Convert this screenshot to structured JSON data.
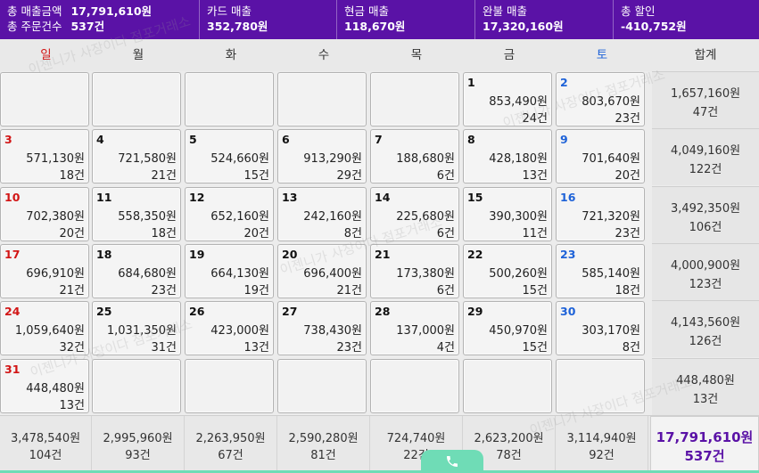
{
  "header": {
    "total_sales_label": "총 매출금액",
    "total_sales_value": "17,791,610원",
    "total_orders_label": "총 주문건수",
    "total_orders_value": "537건",
    "card_label": "카드 매출",
    "card_value": "352,780원",
    "cash_label": "현금 매출",
    "cash_value": "118,670원",
    "complete_label": "완불 매출",
    "complete_value": "17,320,160원",
    "discount_label": "총 할인",
    "discount_value": "-410,752원"
  },
  "weekdays": [
    "일",
    "월",
    "화",
    "수",
    "목",
    "금",
    "토"
  ],
  "sum_header": "합계",
  "weeks": [
    {
      "days": [
        null,
        null,
        null,
        null,
        null,
        {
          "day": "1",
          "amount": "853,490원",
          "count": "24건"
        },
        {
          "day": "2",
          "amount": "803,670원",
          "count": "23건"
        }
      ],
      "sum_amount": "1,657,160원",
      "sum_count": "47건"
    },
    {
      "days": [
        {
          "day": "3",
          "amount": "571,130원",
          "count": "18건"
        },
        {
          "day": "4",
          "amount": "721,580원",
          "count": "21건"
        },
        {
          "day": "5",
          "amount": "524,660원",
          "count": "15건"
        },
        {
          "day": "6",
          "amount": "913,290원",
          "count": "29건"
        },
        {
          "day": "7",
          "amount": "188,680원",
          "count": "6건"
        },
        {
          "day": "8",
          "amount": "428,180원",
          "count": "13건"
        },
        {
          "day": "9",
          "amount": "701,640원",
          "count": "20건"
        }
      ],
      "sum_amount": "4,049,160원",
      "sum_count": "122건"
    },
    {
      "days": [
        {
          "day": "10",
          "amount": "702,380원",
          "count": "20건"
        },
        {
          "day": "11",
          "amount": "558,350원",
          "count": "18건"
        },
        {
          "day": "12",
          "amount": "652,160원",
          "count": "20건"
        },
        {
          "day": "13",
          "amount": "242,160원",
          "count": "8건"
        },
        {
          "day": "14",
          "amount": "225,680원",
          "count": "6건"
        },
        {
          "day": "15",
          "amount": "390,300원",
          "count": "11건"
        },
        {
          "day": "16",
          "amount": "721,320원",
          "count": "23건"
        }
      ],
      "sum_amount": "3,492,350원",
      "sum_count": "106건"
    },
    {
      "days": [
        {
          "day": "17",
          "amount": "696,910원",
          "count": "21건"
        },
        {
          "day": "18",
          "amount": "684,680원",
          "count": "23건"
        },
        {
          "day": "19",
          "amount": "664,130원",
          "count": "19건"
        },
        {
          "day": "20",
          "amount": "696,400원",
          "count": "21건"
        },
        {
          "day": "21",
          "amount": "173,380원",
          "count": "6건"
        },
        {
          "day": "22",
          "amount": "500,260원",
          "count": "15건"
        },
        {
          "day": "23",
          "amount": "585,140원",
          "count": "18건"
        }
      ],
      "sum_amount": "4,000,900원",
      "sum_count": "123건"
    },
    {
      "days": [
        {
          "day": "24",
          "amount": "1,059,640원",
          "count": "32건"
        },
        {
          "day": "25",
          "amount": "1,031,350원",
          "count": "31건"
        },
        {
          "day": "26",
          "amount": "423,000원",
          "count": "13건"
        },
        {
          "day": "27",
          "amount": "738,430원",
          "count": "23건"
        },
        {
          "day": "28",
          "amount": "137,000원",
          "count": "4건"
        },
        {
          "day": "29",
          "amount": "450,970원",
          "count": "15건"
        },
        {
          "day": "30",
          "amount": "303,170원",
          "count": "8건"
        }
      ],
      "sum_amount": "4,143,560원",
      "sum_count": "126건"
    },
    {
      "days": [
        {
          "day": "31",
          "amount": "448,480원",
          "count": "13건"
        },
        null,
        null,
        null,
        null,
        null,
        null
      ],
      "sum_amount": "448,480원",
      "sum_count": "13건"
    }
  ],
  "weekday_totals": [
    {
      "amount": "3,478,540원",
      "count": "104건"
    },
    {
      "amount": "2,995,960원",
      "count": "93건"
    },
    {
      "amount": "2,263,950원",
      "count": "67건"
    },
    {
      "amount": "2,590,280원",
      "count": "81건"
    },
    {
      "amount": "724,740원",
      "count": "22건"
    },
    {
      "amount": "2,623,200원",
      "count": "78건"
    },
    {
      "amount": "3,114,940원",
      "count": "92건"
    }
  ],
  "grand_total": {
    "amount": "17,791,610원",
    "count": "537건"
  },
  "watermark": "이젠니가 사장이다 점포거래소",
  "colors": {
    "header_bg": "#5a12a6",
    "sunday": "#d21515",
    "saturday": "#1e62d8",
    "call_button": "#6fdcb6"
  },
  "icons": {
    "call": "phone-icon"
  }
}
